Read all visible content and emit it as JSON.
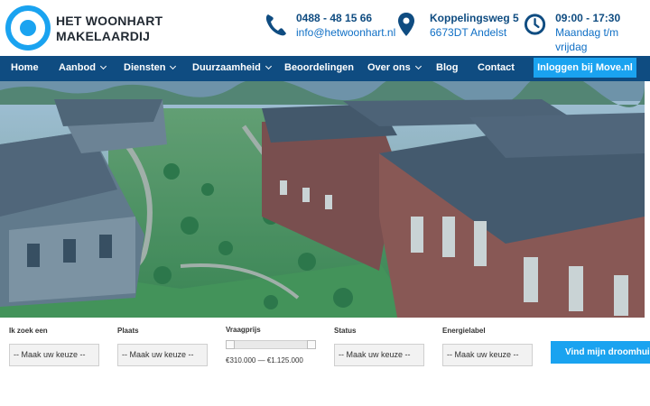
{
  "brand": {
    "line1": "HET WOONHART",
    "line2": "MAKELAARDIJ",
    "logo_icon": "circle-logo-icon"
  },
  "contact": [
    {
      "icon": "phone-icon",
      "line1": "0488 - 48 15 66",
      "line2": "info@hetwoonhart.nl"
    },
    {
      "icon": "location-pin-icon",
      "line1": "Koppelingsweg 5",
      "line2": "6673DT Andelst"
    },
    {
      "icon": "clock-icon",
      "line1": "09:00 - 17:30",
      "line2": "Maandag t/m vrijdag"
    }
  ],
  "nav": {
    "items": [
      {
        "label": "Home",
        "dropdown": false
      },
      {
        "label": "Aanbod",
        "dropdown": true
      },
      {
        "label": "Diensten",
        "dropdown": true
      },
      {
        "label": "Duurzaamheid",
        "dropdown": true
      },
      {
        "label": "Beoordelingen",
        "dropdown": false
      },
      {
        "label": "Over ons",
        "dropdown": true
      },
      {
        "label": "Blog",
        "dropdown": false
      },
      {
        "label": "Contact",
        "dropdown": false
      }
    ],
    "login_label": "Inloggen bij Move.nl"
  },
  "search": {
    "type_label": "Ik zoek een",
    "type_value": "-- Maak uw keuze --",
    "place_label": "Plaats",
    "place_value": "-- Maak uw keuze --",
    "price_label": "Vraagprijs",
    "price_range": "€310.000 — €1.125.000",
    "status_label": "Status",
    "status_value": "-- Maak uw keuze --",
    "energy_label": "Energielabel",
    "energy_value": "-- Maak uw keuze --",
    "submit_label": "Vind mijn droomhuis"
  },
  "colors": {
    "navy": "#0f4c81",
    "accent": "#1aa3f0",
    "logo": "#1aa3f0"
  }
}
